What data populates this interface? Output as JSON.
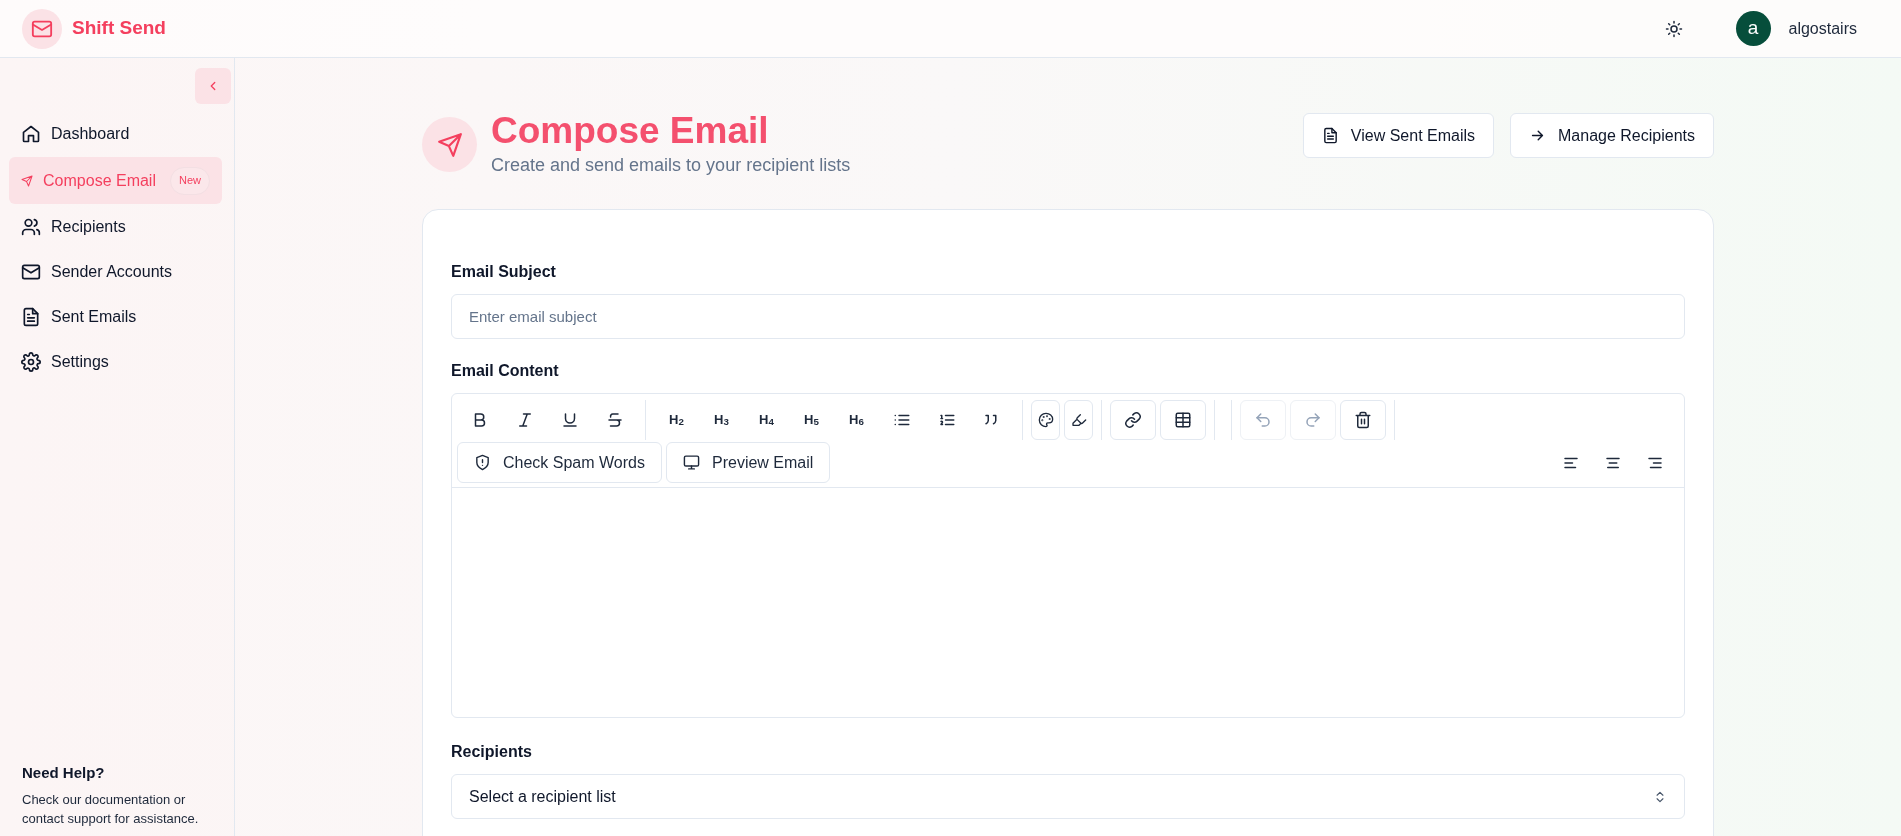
{
  "app": {
    "name": "Shift Send"
  },
  "header": {
    "user": {
      "initial": "a",
      "name": "algostairs"
    }
  },
  "sidebar": {
    "items": [
      {
        "label": "Dashboard",
        "selected": false
      },
      {
        "label": "Compose Email",
        "selected": true,
        "badge": "New"
      },
      {
        "label": "Recipients",
        "selected": false
      },
      {
        "label": "Sender Accounts",
        "selected": false
      },
      {
        "label": "Sent Emails",
        "selected": false
      },
      {
        "label": "Settings",
        "selected": false
      }
    ],
    "help": {
      "title": "Need Help?",
      "text": "Check our documentation or contact support for assistance."
    }
  },
  "page": {
    "title": "Compose Email",
    "subtitle": "Create and send emails to your recipient lists",
    "actions": [
      "View Sent Emails",
      "Manage Recipients"
    ]
  },
  "form": {
    "subject": {
      "label": "Email Subject",
      "placeholder": "Enter email subject"
    },
    "content": {
      "label": "Email Content",
      "toolbar_groups": [
        {
          "kind": "plain",
          "items": [
            {
              "disabled": false
            },
            {
              "disabled": false
            },
            {
              "disabled": false
            },
            {
              "disabled": false
            }
          ]
        },
        {
          "kind": "plain",
          "items": [
            {
              "text": "H$_{2}$",
              "disabled": false
            },
            {
              "text": "H$_{3}$",
              "disabled": false
            },
            {
              "text": "H$_{4}$",
              "disabled": false
            },
            {
              "text": "H$_{5}$",
              "disabled": false
            },
            {
              "text": "H$_{6}$",
              "disabled": false
            },
            {
              "disabled": false
            },
            {
              "disabled": false
            },
            {
              "disabled": false
            }
          ]
        },
        {
          "kind": "boxed",
          "items": [
            {
              "disabled": false
            },
            {
              "disabled": false
            }
          ]
        },
        {
          "kind": "boxed",
          "items": [
            {
              "disabled": false
            },
            {
              "disabled": false
            }
          ]
        },
        {
          "kind": "boxed",
          "items": [
            {
              "disabled": true
            },
            {
              "disabled": true
            },
            {
              "disabled": false
            }
          ]
        }
      ],
      "actions": [
        "Check Spam Words",
        "Preview Email"
      ]
    },
    "recipients": {
      "label": "Recipients",
      "placeholder": "Select a recipient list"
    }
  }
}
